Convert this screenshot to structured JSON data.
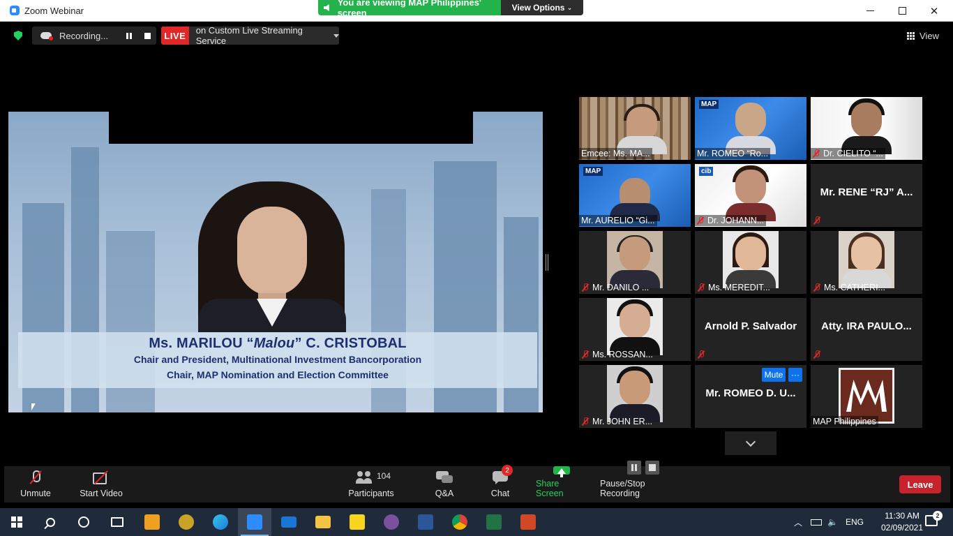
{
  "window": {
    "title": "Zoom Webinar"
  },
  "share_banner": {
    "message": "You are viewing MAP Philippines' screen",
    "view_options": "View Options"
  },
  "status": {
    "recording_label": "Recording...",
    "live_label": "LIVE",
    "live_service": "on Custom Live Streaming Service",
    "view_label": "View"
  },
  "shared_screen": {
    "speaker_name": "Ms. MARILOU “Malou” C. CRISTOBAL",
    "line1": "Chair and President, Multinational Investment Bancorporation",
    "line2": "Chair, MAP Nomination and Election Committee"
  },
  "gallery": [
    {
      "name": "Emcee: Ms. MA...",
      "muted": false,
      "active": true
    },
    {
      "name": "Mr. ROMEO “Ro...",
      "muted": false,
      "active": false
    },
    {
      "name": "Dr. CIELITO “...",
      "muted": true,
      "active": false
    },
    {
      "name": "Mr. AURELIO “Gi...",
      "muted": false,
      "active": false
    },
    {
      "name": "Dr. JOHANN...",
      "muted": true,
      "active": false
    },
    {
      "name": "Mr. RENE “RJ” A...",
      "muted": true,
      "active": false
    },
    {
      "name": "Mr. DANILO ...",
      "muted": true,
      "active": false
    },
    {
      "name": "Ms. MEREDIT...",
      "muted": true,
      "active": false
    },
    {
      "name": "Ms. CATHERI...",
      "muted": true,
      "active": false
    },
    {
      "name": "Ms. ROSSAN...",
      "muted": true,
      "active": false
    },
    {
      "name": "Arnold P. Salvador",
      "muted": true,
      "active": false
    },
    {
      "name": "Atty. IRA PAULO...",
      "muted": true,
      "active": false
    },
    {
      "name": "Mr. JOHN ER...",
      "muted": true,
      "active": false
    },
    {
      "name": "Mr. ROMEO D. U...",
      "muted": false,
      "active": false
    },
    {
      "name": "MAP Philippines",
      "muted": false,
      "active": false
    }
  ],
  "gallery_actions": {
    "mute": "Mute",
    "more": "···"
  },
  "toolbar": {
    "unmute": "Unmute",
    "start_video": "Start Video",
    "participants": "Participants",
    "participant_count": "104",
    "qa": "Q&A",
    "chat": "Chat",
    "chat_badge": "2",
    "share_screen": "Share Screen",
    "pause_stop": "Pause/Stop Recording",
    "leave": "Leave"
  },
  "taskbar": {
    "lang": "ENG",
    "time": "11:30 AM",
    "date": "02/09/2021",
    "notifications": "2"
  },
  "colors": {
    "accent_green": "#23b24b",
    "live_red": "#e02828",
    "active_speaker": "#d8e83a",
    "leave_red": "#c8222a"
  }
}
